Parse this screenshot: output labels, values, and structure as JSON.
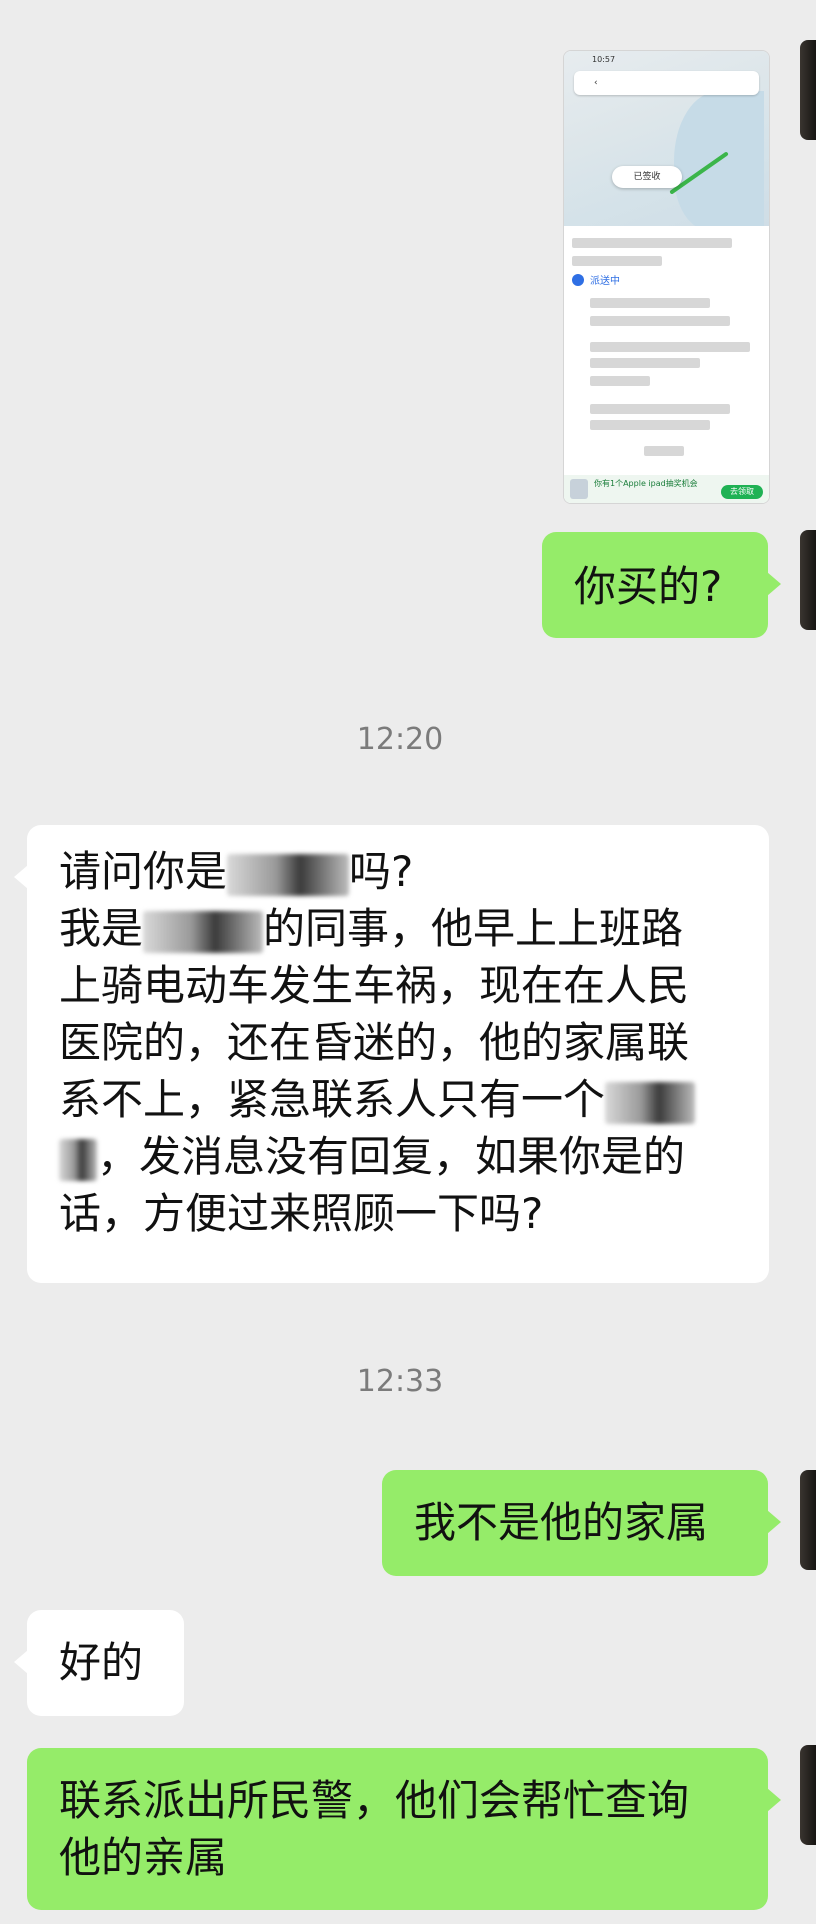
{
  "messages": {
    "m1_text": "你买的?",
    "time1": "12:20",
    "m2_l1_a": "请问你是",
    "m2_l1_b": "吗?",
    "m2_l2_a": "我是",
    "m2_l2_b": "的同事，他早上上班路",
    "m2_l3": "上骑电动车发生车祸，现在在人民",
    "m2_l4": "医院的，还在昏迷的，他的家属联",
    "m2_l5_a": "系不上，紧急联系人只有一个",
    "m2_l6_b": "，发消息没有回复，如果你是的",
    "m2_l7": "话，方便过来照顾一下吗?",
    "time2": "12:33",
    "m3_text": "我不是他的家属",
    "m4_text": "好的",
    "m5_l1": "联系派出所民警，他们会帮忙查询",
    "m5_l2": "他的亲属"
  },
  "thumbnail": {
    "status_bar": "10:57",
    "pill": "已签收",
    "status_label": "派送中",
    "ad_text": "你有1个Apple ipad抽奖机会",
    "ad_button": "去领取"
  },
  "colors": {
    "background": "#ececec",
    "sent_bubble": "#95ec69",
    "received_bubble": "#ffffff",
    "timestamp": "#7b7b7b"
  }
}
